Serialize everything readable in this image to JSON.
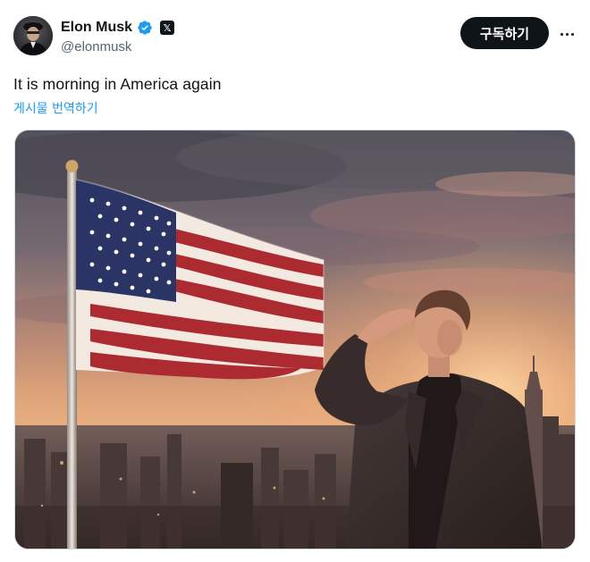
{
  "post": {
    "author": {
      "display_name": "Elon Musk",
      "handle": "@elonmusk",
      "verified_icon": "verified-badge-icon",
      "affiliation_icon": "x-logo-icon",
      "affiliation_glyph": "𝕏"
    },
    "actions": {
      "subscribe_label": "구독하기",
      "more_icon": "more-horizontal-icon"
    },
    "text": "It is morning in America again",
    "translate_label": "게시물 번역하기",
    "media": {
      "type": "image",
      "content": "man saluting beside waving American flag over city at sunset"
    }
  },
  "colors": {
    "text_primary": "#0f1419",
    "text_secondary": "#536471",
    "link": "#1d9bf0",
    "verified": "#1d9bf0",
    "button_bg": "#0f1419"
  }
}
